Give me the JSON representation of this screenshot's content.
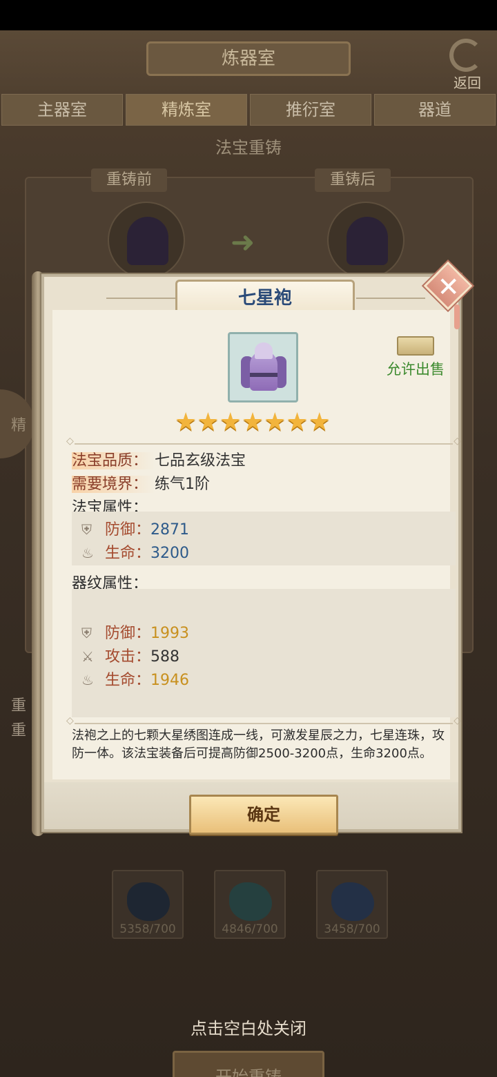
{
  "background": {
    "screen_title": "炼器室",
    "back_label": "返回",
    "tabs": [
      "主器室",
      "精炼室",
      "推衍室",
      "器道"
    ],
    "section_title": "法宝重铸",
    "before_label": "重铸前",
    "after_label": "重铸后",
    "side_tab_label": "精",
    "left_text_1": "重",
    "left_text_2": "重",
    "materials": [
      "5358/700",
      "4846/700",
      "3458/700"
    ],
    "start_button": "开始重铸"
  },
  "modal": {
    "title": "七星袍",
    "item_icon": "purple-robe-icon",
    "sale_label": "允许出售",
    "stars": "★★★★★★★",
    "star_count": 7,
    "quality": {
      "key": "法宝品质：",
      "value": "七品玄级法宝"
    },
    "realm": {
      "key": "需要境界：",
      "value": "练气1阶"
    },
    "attr_title": "法宝属性：",
    "attributes": [
      {
        "icon": "shield-icon",
        "key": "防御：",
        "value": "2871"
      },
      {
        "icon": "life-icon",
        "key": "生命：",
        "value": "3200"
      }
    ],
    "pattern_title": "器纹属性：",
    "pattern_attributes": [
      {
        "icon": "shield-icon",
        "key": "防御：",
        "value": "1993"
      },
      {
        "icon": "sword-icon",
        "key": "攻击：",
        "value": "588"
      },
      {
        "icon": "life-icon",
        "key": "生命：",
        "value": "1946"
      }
    ],
    "description": "法袍之上的七颗大星绣图连成一线，可激发星辰之力，七星连珠，攻防一体。该法宝装备后可提高防御2500-3200点，生命3200点。",
    "confirm_button": "确定"
  },
  "close_hint": "点击空白处关闭"
}
